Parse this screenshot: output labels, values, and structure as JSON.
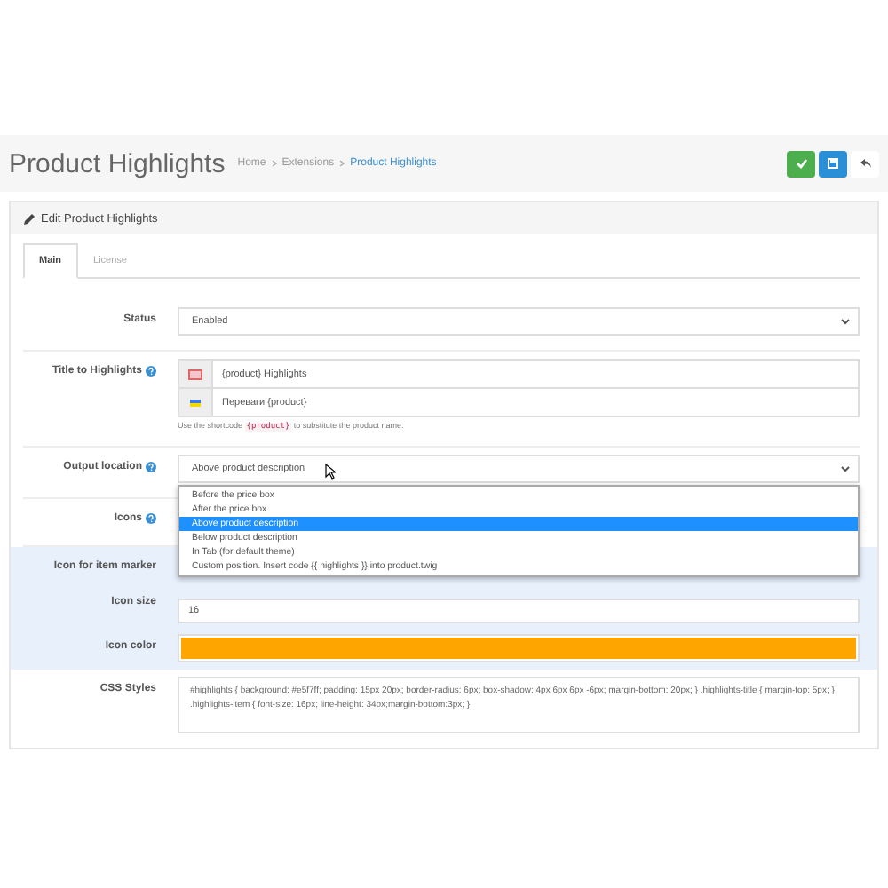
{
  "header": {
    "title": "Product Highlights",
    "breadcrumbs": [
      {
        "label": "Home",
        "selected": false
      },
      {
        "label": "Extensions",
        "selected": false
      },
      {
        "label": "Product Highlights",
        "selected": true
      }
    ]
  },
  "panel": {
    "title": "Edit Product Highlights"
  },
  "tabs": [
    {
      "label": "Main",
      "selected": true
    },
    {
      "label": "License",
      "selected": false
    }
  ],
  "status": {
    "label": "Status",
    "value": "Enabled"
  },
  "title_field": {
    "label": "Title to Highlights",
    "languages": [
      {
        "kind": "en",
        "value": "{product} Highlights"
      },
      {
        "kind": "ua",
        "value": "Переваги {product}"
      }
    ],
    "hint_before": "Use the shortcode",
    "hint_code": "{product}",
    "hint_after": "to substitute the product name."
  },
  "output": {
    "label": "Output location",
    "value": "Above product description",
    "options": [
      {
        "label": "Before the price box",
        "selected": false
      },
      {
        "label": "After the price box",
        "selected": false
      },
      {
        "label": "Above product description",
        "selected": true
      },
      {
        "label": "Below product description",
        "selected": false
      },
      {
        "label": "In Tab (for default theme)",
        "selected": false
      },
      {
        "label": "Custom position. Insert code {{ highlights }} into product.twig",
        "selected": false
      }
    ]
  },
  "icons_label": "Icons",
  "icon_marker": {
    "label": "Icon for item marker"
  },
  "icon_size": {
    "label": "Icon size",
    "value": "16"
  },
  "icon_color": {
    "label": "Icon color",
    "color": "#ffa500"
  },
  "css": {
    "label": "CSS Styles",
    "value": "#highlights { background: #e5f7ff; padding: 15px 20px; border-radius: 6px; box-shadow: 4px 6px 6px -6px; margin-bottom: 20px; } .highlights-title { margin-top: 5px; } .highlights-item { font-size: 16px; line-height: 34px;margin-bottom:3px; }"
  }
}
